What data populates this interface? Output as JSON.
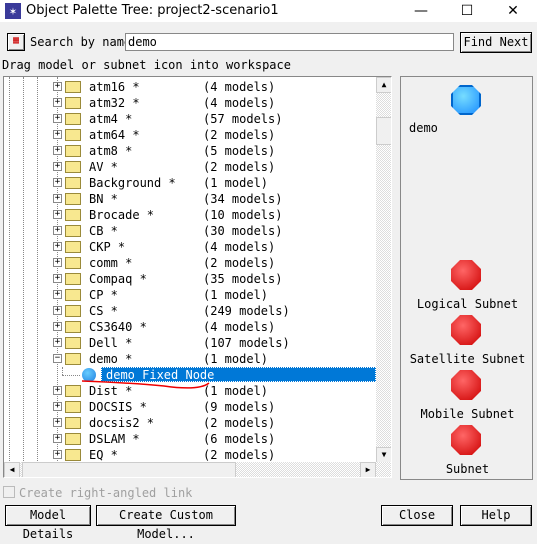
{
  "window": {
    "title": "Object Palette Tree: project2-scenario1",
    "minimize": "—",
    "maximize": "☐",
    "close": "✕"
  },
  "search": {
    "label": "Search by name:",
    "value": "demo",
    "find_next": "Find Next"
  },
  "instruction": "Drag model or subnet icon into workspace",
  "tree": {
    "items": [
      {
        "name": "atm16 *",
        "count": "(4 models)"
      },
      {
        "name": "atm32 *",
        "count": "(4 models)"
      },
      {
        "name": "atm4 *",
        "count": "(57 models)"
      },
      {
        "name": "atm64 *",
        "count": "(2 models)"
      },
      {
        "name": "atm8 *",
        "count": "(5 models)"
      },
      {
        "name": "AV *",
        "count": "(2 models)"
      },
      {
        "name": "Background *",
        "count": "(1 model)"
      },
      {
        "name": "BN *",
        "count": "(34 models)"
      },
      {
        "name": "Brocade *",
        "count": "(10 models)"
      },
      {
        "name": "CB *",
        "count": "(30 models)"
      },
      {
        "name": "CKP *",
        "count": "(4 models)"
      },
      {
        "name": "comm *",
        "count": "(2 models)"
      },
      {
        "name": "Compaq *",
        "count": "(35 models)"
      },
      {
        "name": "CP *",
        "count": "(1 model)"
      },
      {
        "name": "CS *",
        "count": "(249 models)"
      },
      {
        "name": "CS3640 *",
        "count": "(4 models)"
      },
      {
        "name": "Dell *",
        "count": "(107 models)"
      },
      {
        "name": "demo *",
        "count": "(1 model)",
        "expanded": true
      },
      {
        "name": "demo   Fixed Node",
        "count": "",
        "child": true,
        "selected": true
      },
      {
        "name": "Dist *",
        "count": "(1 model)"
      },
      {
        "name": "DOCSIS *",
        "count": "(9 models)"
      },
      {
        "name": "docsis2 *",
        "count": "(2 models)"
      },
      {
        "name": "DSLAM *",
        "count": "(6 models)"
      },
      {
        "name": "EQ *",
        "count": "(2 models)"
      }
    ]
  },
  "palette": {
    "items": [
      {
        "label": "demo",
        "icon": "fixed-node-icon",
        "color": "#1e90ff"
      },
      {
        "label": "Logical Subnet",
        "icon": "subnet-icon",
        "color": "#e02020"
      },
      {
        "label": "Satellite Subnet",
        "icon": "subnet-icon",
        "color": "#e02020"
      },
      {
        "label": "Mobile Subnet",
        "icon": "subnet-icon",
        "color": "#e02020"
      },
      {
        "label": "Subnet",
        "icon": "subnet-icon",
        "color": "#e02020"
      }
    ]
  },
  "checkbox": {
    "label": "Create right-angled link",
    "checked": false,
    "enabled": false
  },
  "buttons": {
    "model_details": "Model Details",
    "create_custom": "Create Custom Model...",
    "close": "Close",
    "help": "Help"
  },
  "colors": {
    "selection": "#0078d7"
  }
}
